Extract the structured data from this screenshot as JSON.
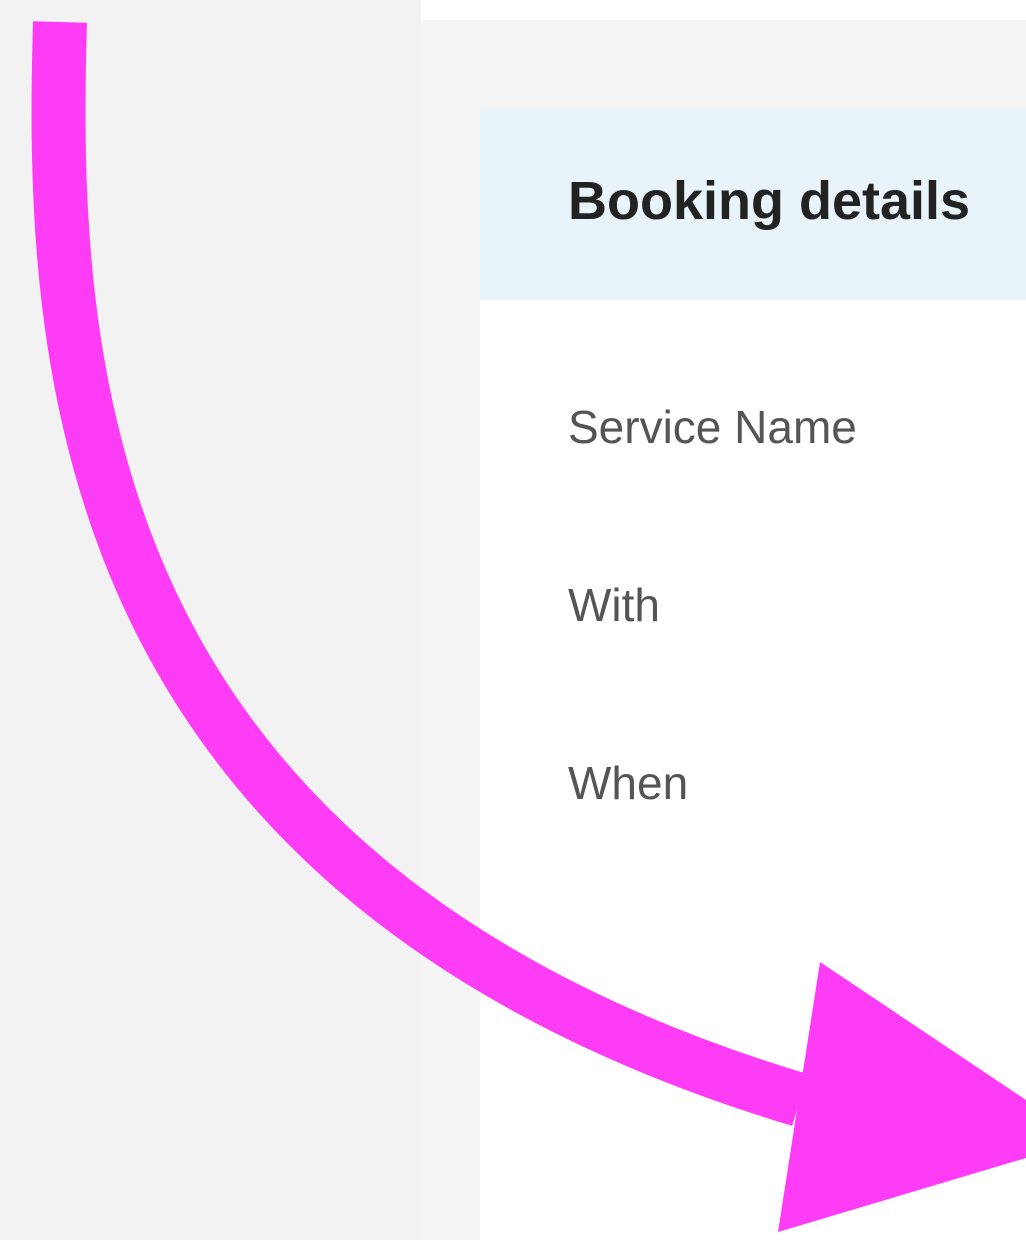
{
  "booking": {
    "title": "Booking details",
    "labels": {
      "service_name": "Service Name",
      "with": "With",
      "when": "When"
    }
  },
  "colors": {
    "header_bg": "#e8f4fa",
    "button_border": "#2a8fb0",
    "annotation_arrow": "#ff3cf5"
  },
  "annotation": {
    "icon": "curved-arrow-icon"
  }
}
